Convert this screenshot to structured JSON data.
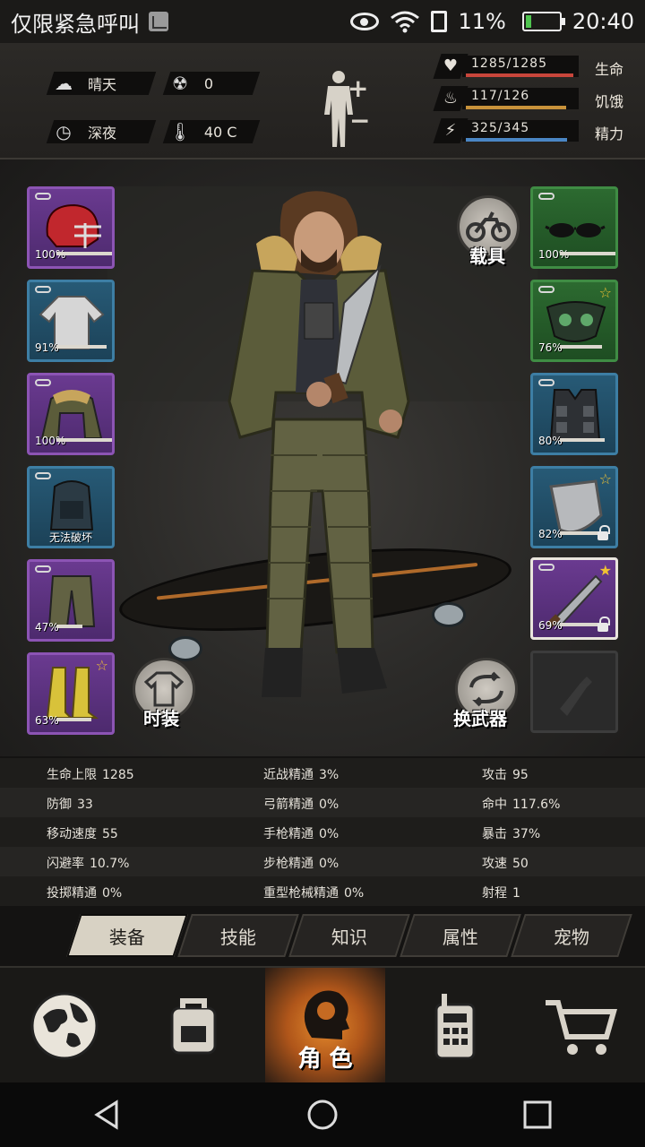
{
  "status_bar": {
    "left_text": "仅限紧急呼叫",
    "battery_text": "11%",
    "time": "20:40"
  },
  "hud": {
    "weather": "晴天",
    "radiation": "0",
    "time_of_day": "深夜",
    "temperature": "40 C",
    "stats": [
      {
        "label": "生命",
        "value": "1285/1285",
        "fraction": 1.0,
        "color": "#c8463b"
      },
      {
        "label": "饥饿",
        "value": "117/126",
        "fraction": 0.93,
        "color": "#c8923a"
      },
      {
        "label": "精力",
        "value": "325/345",
        "fraction": 0.94,
        "color": "#4a86c4"
      }
    ]
  },
  "left_slots": [
    {
      "name": "helmet",
      "rarity": "purple",
      "percent": "100%",
      "durability": 1.0
    },
    {
      "name": "shirt",
      "rarity": "blue",
      "percent": "91%",
      "durability": 0.91
    },
    {
      "name": "jacket",
      "rarity": "purple",
      "percent": "100%",
      "durability": 1.0
    },
    {
      "name": "backpack",
      "rarity": "blue",
      "label": "无法破坏"
    },
    {
      "name": "pants",
      "rarity": "purple",
      "percent": "47%",
      "durability": 0.47
    },
    {
      "name": "boots",
      "rarity": "purple",
      "percent": "63%",
      "durability": 0.63
    }
  ],
  "right_slots": [
    {
      "name": "glasses",
      "rarity": "green",
      "percent": "100%",
      "durability": 1.0
    },
    {
      "name": "mask",
      "rarity": "green",
      "percent": "76%",
      "durability": 0.76
    },
    {
      "name": "vest",
      "rarity": "blue",
      "percent": "80%",
      "durability": 0.8
    },
    {
      "name": "shield",
      "rarity": "blue",
      "percent": "82%",
      "durability": 0.82
    },
    {
      "name": "machete",
      "rarity": "purple",
      "percent": "69%",
      "durability": 0.69
    },
    {
      "name": "empty-slot",
      "rarity": "empty"
    }
  ],
  "buttons": {
    "vehicle": "载具",
    "fashion": "时装",
    "swap_weapon": "换武器"
  },
  "attributes": [
    [
      "生命上限",
      "1285",
      "近战精通",
      "3%",
      "攻击",
      "95"
    ],
    [
      "防御",
      "33",
      "弓箭精通",
      "0%",
      "命中",
      "117.6%"
    ],
    [
      "移动速度",
      "55",
      "手枪精通",
      "0%",
      "暴击",
      "37%"
    ],
    [
      "闪避率",
      "10.7%",
      "步枪精通",
      "0%",
      "攻速",
      "50"
    ],
    [
      "投掷精通",
      "0%",
      "重型枪械精通",
      "0%",
      "射程",
      "1"
    ]
  ],
  "tabs": [
    "装备",
    "技能",
    "知识",
    "属性",
    "宠物"
  ],
  "active_tab": "装备",
  "bottom_nav": {
    "active_label": "角 色"
  }
}
